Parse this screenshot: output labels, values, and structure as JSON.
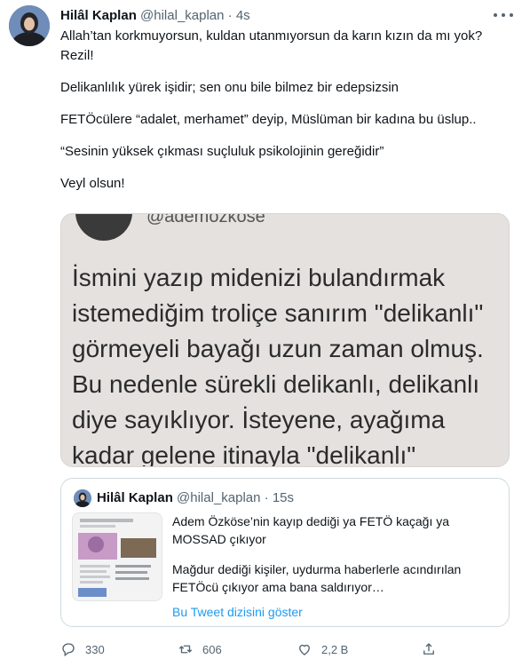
{
  "tweet": {
    "author_name": "Hilâl Kaplan",
    "author_handle": "@hilal_kaplan",
    "separator": "·",
    "time": "4s",
    "lines": [
      "Allah’tan korkmuyorsun, kuldan utanmıyorsun da karın kızın da mı yok? Rezil!",
      "Delikanlılık yürek işidir; sen onu bile bilmez bir edepsizsin",
      "FETÖcülere “adalet, merhamet” deyip, Müslüman bir kadına bu üslup..",
      "“Sesinin yüksek çıkması suçluluk psikolojinin gereğidir”",
      "Veyl olsun!"
    ]
  },
  "media": {
    "handle": "@ademozkose",
    "caption": "İsmini yazıp midenizi bulandırmak istemediğim troliçe sanırım \"delikanlı\" görmeyeli bayağı uzun zaman olmuş. Bu nedenle sürekli delikanlı, delikanlı diye sayıklıyor. İsteyene, ayağıma kadar gelene itinayla \"delikanlı\""
  },
  "quote": {
    "author_name": "Hilâl Kaplan",
    "author_handle": "@hilal_kaplan",
    "separator": "·",
    "time": "15s",
    "text1": "Adem Özköse’nin kayıp dediği ya FETÖ kaçağı ya MOSSAD çıkıyor",
    "text2": "Mağdur dediği kişiler, uydurma haberlerle acındırılan FETÖcü çıkıyor ama bana saldırıyor…",
    "show_thread": "Bu Tweet dizisini göster"
  },
  "actions": {
    "reply_count": "330",
    "retweet_count": "606",
    "like_count": "2,2 B"
  }
}
